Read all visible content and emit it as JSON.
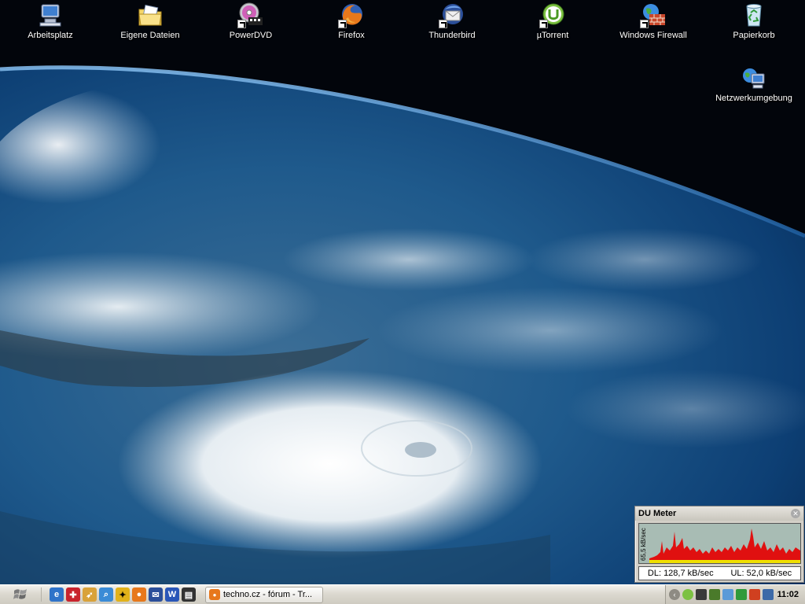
{
  "desktop": {
    "icons": [
      {
        "label": "Arbeitsplatz",
        "icon": "computer-icon"
      },
      {
        "label": "Eigene Dateien",
        "icon": "documents-folder-icon"
      },
      {
        "label": "PowerDVD",
        "icon": "powerdvd-icon"
      },
      {
        "label": "Firefox",
        "icon": "firefox-icon"
      },
      {
        "label": "Thunderbird",
        "icon": "thunderbird-icon"
      },
      {
        "label": "µTorrent",
        "icon": "utorrent-icon"
      },
      {
        "label": "Windows Firewall",
        "icon": "firewall-icon"
      },
      {
        "label": "Papierkorb",
        "icon": "recycle-bin-icon"
      },
      {
        "label": "Netzwerkumgebung",
        "icon": "network-icon"
      }
    ]
  },
  "dumeter": {
    "title": "DU Meter",
    "scale": "65,5 kB/sec",
    "download": "DL: 128,7 kB/sec",
    "upload": "UL: 52,0 kB/sec",
    "colors": {
      "download": "#e01010",
      "upload": "#f0e000",
      "graph_bg": "#a8bcb4"
    }
  },
  "taskbar": {
    "window_title": "techno.cz - fórum - Tr...",
    "clock": "11:02",
    "quick_launch": [
      "ie-icon",
      "app-red-icon",
      "rocket-icon",
      "search-icon",
      "aim-icon",
      "firefox-icon",
      "thunderbird-icon",
      "word-icon",
      "terminal-icon"
    ],
    "tray": [
      "utorrent-icon",
      "network-icon",
      "usb-icon",
      "volume-icon",
      "arrows-icon",
      "activity-icon",
      "shield-icon"
    ]
  }
}
